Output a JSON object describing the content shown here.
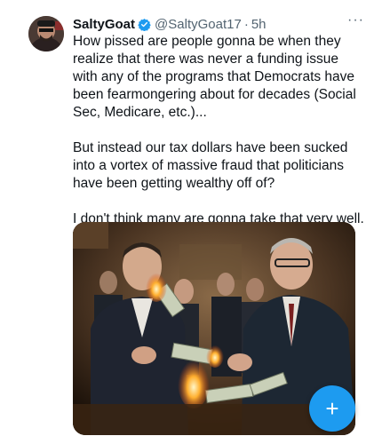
{
  "tweet": {
    "display_name": "SaltyGoat",
    "handle": "@SaltyGoat17",
    "separator": "·",
    "time": "5h",
    "more_label": "···",
    "paragraphs": [
      "How pissed are people gonna be when they realize that there was never a funding issue with any of the programs that Democrats have been fearmongering about for decades (Social Sec, Medicare, etc.)...",
      "But instead our tax dollars have been sucked into a vortex of massive fraud that politicians have been getting wealthy off of?",
      "I don't think many are gonna take that very well."
    ],
    "verified_color": "#1d9bf0",
    "media_icon": "photo-burning-money-image"
  },
  "compose_fab": {
    "label": "+",
    "color": "#1d9bf0"
  }
}
